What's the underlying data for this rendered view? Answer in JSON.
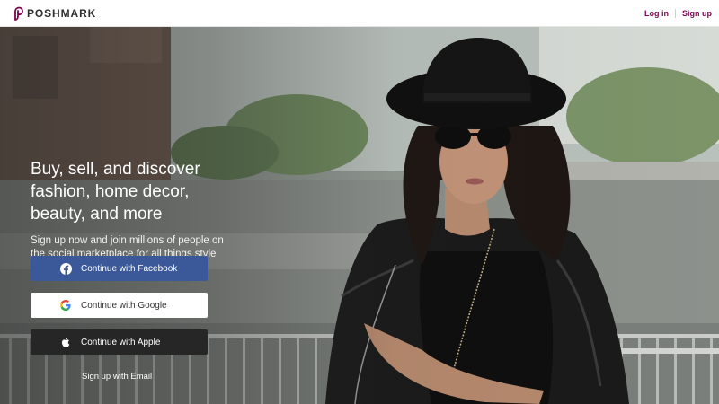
{
  "header": {
    "brand": "POSHMARK",
    "login_label": "Log in",
    "signup_label": "Sign up"
  },
  "hero": {
    "headline": "Buy, sell, and discover fashion, home decor, beauty, and more",
    "subhead": "Sign up now and join millions of people on the social marketplace for all things style",
    "buttons": {
      "facebook": "Continue with Facebook",
      "google": "Continue with Google",
      "apple": "Continue with Apple"
    },
    "email_link": "Sign up with Email"
  },
  "colors": {
    "brand": "#7f0353",
    "facebook": "#3b5998",
    "apple": "#262626",
    "google_blue": "#4285F4",
    "google_red": "#EA4335",
    "google_yellow": "#FBBC05",
    "google_green": "#34A853"
  },
  "icons": [
    "poshmark-logo-icon",
    "facebook-icon",
    "google-icon",
    "apple-icon"
  ]
}
